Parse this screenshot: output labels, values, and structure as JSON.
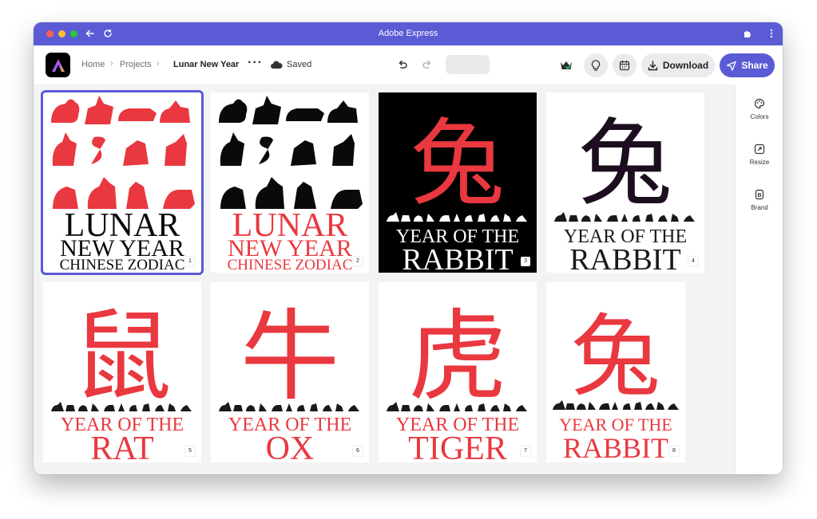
{
  "window": {
    "title": "Adobe Express"
  },
  "breadcrumb": {
    "home": "Home",
    "projects": "Projects",
    "current": "Lunar New Year"
  },
  "status": {
    "saved": "Saved"
  },
  "actions": {
    "download": "Download",
    "share": "Share"
  },
  "right_panel": {
    "items": [
      "Colors",
      "Resize",
      "Brand"
    ]
  },
  "colors": {
    "accent": "#5b5bd6",
    "red": "#e9383f",
    "black": "#0a0a0a",
    "dark_purple": "#1c0e1f"
  },
  "pages": [
    {
      "number": "1",
      "text": {
        "l1": "LUNAR",
        "l2": "NEW YEAR",
        "l3": "CHINESE ZODIAC"
      }
    },
    {
      "number": "2",
      "text": {
        "l1": "LUNAR",
        "l2": "NEW YEAR",
        "l3": "CHINESE ZODIAC"
      }
    },
    {
      "number": "3",
      "char": "兔",
      "line1": "YEAR OF THE",
      "line2": "RABBIT"
    },
    {
      "number": "4",
      "char": "兔",
      "line1": "YEAR OF THE",
      "line2": "RABBIT"
    },
    {
      "number": "5",
      "char": "鼠",
      "line1": "YEAR OF THE",
      "line2": "RAT"
    },
    {
      "number": "6",
      "char": "牛",
      "line1": "YEAR OF THE",
      "line2": "OX"
    },
    {
      "number": "7",
      "char": "虎",
      "line1": "YEAR OF THE",
      "line2": "TIGER"
    },
    {
      "number": "8",
      "char": "兔",
      "line1": "YEAR OF THE",
      "line2": "RABBIT"
    }
  ],
  "icons": {
    "back": "arrow-left-icon",
    "reload": "reload-icon",
    "extensions": "puzzle-icon",
    "menu": "kebab-icon",
    "more": "more-dots-icon",
    "cloud": "cloud-icon",
    "undo": "undo-icon",
    "redo": "redo-icon",
    "premium": "crown-check-icon",
    "ideas": "lightbulb-icon",
    "schedule": "calendar-icon",
    "colors": "palette-icon",
    "resize": "resize-icon",
    "brand": "brand-icon",
    "toolbar": [
      "check-page-icon",
      "add-page-icon",
      "duplicate-page-icon",
      "trash-icon",
      "fit-icon"
    ]
  }
}
